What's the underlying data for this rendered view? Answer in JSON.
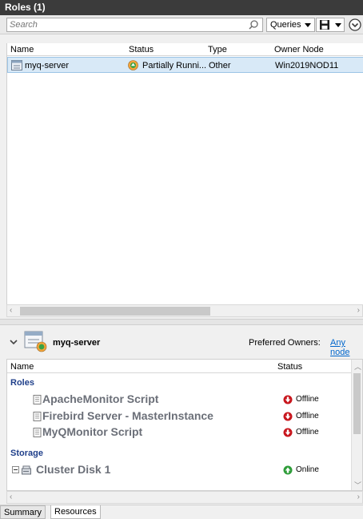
{
  "header": {
    "title": "Roles (1)"
  },
  "search": {
    "placeholder": "Search",
    "queries_label": "Queries"
  },
  "roles_table": {
    "columns": [
      "Name",
      "Status",
      "Type",
      "Owner Node"
    ],
    "rows": [
      {
        "name": "myq-server",
        "status": "Partially Runni...",
        "type": "Other",
        "owner": "Win2019NOD11"
      }
    ]
  },
  "detail": {
    "title": "myq-server",
    "preferred_owners_label": "Preferred Owners:",
    "preferred_owners_link": "Any node",
    "columns": [
      "Name",
      "Status"
    ],
    "groups": [
      {
        "label": "Roles",
        "items": [
          {
            "name": "ApacheMonitor Script",
            "status": "Offline"
          },
          {
            "name": "Firebird Server - MasterInstance",
            "status": "Offline"
          },
          {
            "name": "MyQMonitor Script",
            "status": "Offline"
          }
        ]
      },
      {
        "label": "Storage",
        "items": [
          {
            "name": "Cluster Disk 1",
            "status": "Online"
          }
        ]
      }
    ]
  },
  "tabs": [
    {
      "label": "Summary",
      "active": false
    },
    {
      "label": "Resources",
      "active": true
    }
  ],
  "colors": {
    "header_bg": "#3b3b3b",
    "selection_bg": "#d8e9f7",
    "group_label": "#1f3f8a",
    "link": "#0066cc",
    "offline": "#c8161d",
    "online": "#2f9d3a"
  },
  "icons": {
    "search": "magnifier-icon",
    "save": "floppy-disk-icon",
    "expand": "chevron-circle-down-icon",
    "role": "server-role-icon",
    "status_partial": "partially-running-icon",
    "script": "script-resource-icon",
    "disk": "disk-icon",
    "offline": "offline-arrow-icon",
    "online": "online-arrow-icon"
  }
}
